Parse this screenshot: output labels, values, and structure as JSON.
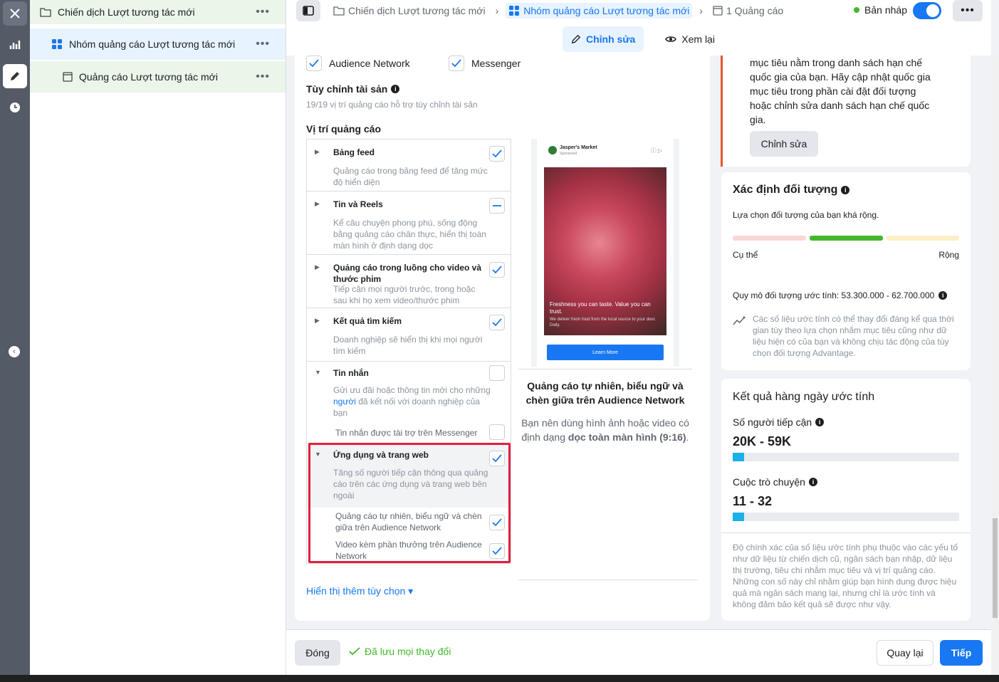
{
  "tree": {
    "campaign": "Chiến dịch Lượt tương tác mới",
    "adset": "Nhóm quảng cáo Lượt tương tác mới",
    "ad": "Quảng cáo Lượt tương tác mới",
    "more": "•••"
  },
  "breadcrumb": {
    "campaign": "Chiến dịch Lượt tương tác mới",
    "adset": "Nhóm quảng cáo Lượt tương tác mới",
    "ads": "1 Quảng cáo"
  },
  "status": {
    "label": "Bản nháp",
    "color": "#42b72a",
    "published": true
  },
  "modes": {
    "edit": "Chỉnh sửa",
    "review": "Xem lại"
  },
  "platforms": {
    "audience_network": "Audience Network",
    "messenger": "Messenger"
  },
  "asset_custom": {
    "title": "Tùy chỉnh tài sản",
    "subtitle": "19/19 vị trí quảng cáo hỗ trợ tùy chỉnh tài sản"
  },
  "placements_title": "Vị trí quảng cáo",
  "placements": [
    {
      "title": "Bảng feed",
      "desc": "Quảng cáo trong bảng feed để tăng mức độ hiển diện",
      "state": "checked"
    },
    {
      "title": "Tin và Reels",
      "desc": "Kể câu chuyện phong phú, sống động bằng quảng cáo chân thực, hiển thị toàn màn hình ở định dạng dọc",
      "state": "partial"
    },
    {
      "title": "Quảng cáo trong luồng cho video và thước phim",
      "desc": "Tiếp cận mọi người trước, trong hoặc sau khi họ xem video/thước phim",
      "state": "checked"
    },
    {
      "title": "Kết quả tìm kiếm",
      "desc": "Doanh nghiệp sẽ hiển thị khi mọi người tìm kiếm",
      "state": "checked"
    },
    {
      "title": "Tin nhắn",
      "desc_a": "Gửi ưu đãi hoặc thông tin mới cho những ",
      "desc_link": "người",
      "desc_b": " đã kết nối với doanh nghiệp của bạn",
      "child": "Tin nhắn được tài trợ trên Messenger",
      "state": "unchecked"
    },
    {
      "title": "Ứng dụng và trang web",
      "desc": "Tăng số người tiếp cận thông qua quảng cáo trên các ứng dụng và trang web bên ngoài",
      "child1": "Quảng cáo tự nhiên, biểu ngữ và chèn giữa trên Audience Network",
      "child2": "Video kèm phần thưởng trên Audience Network",
      "state": "checked"
    }
  ],
  "preview": {
    "brand": "Jasper's Market",
    "sponsored": "Sponsored",
    "caption": "Freshness you can taste. Value you can trust.",
    "caption2": "We deliver fresh food from the local source to your door. Daily.",
    "cta": "Learn More",
    "title": "Quảng cáo tự nhiên, biểu ngữ và chèn giữa trên Audience Network",
    "desc_a": "Bạn nên dùng hình ảnh hoặc video có định dạng ",
    "desc_b": "dọc toàn màn hình (9:16)",
    "desc_c": "."
  },
  "show_more": "Hiển thị thêm tùy chọn",
  "warning": {
    "text": "mục tiêu nằm trong danh sách hạn chế quốc gia của bạn. Hãy cập nhật quốc gia mục tiêu trong phần cài đặt đối tượng hoặc chỉnh sửa danh sách hạn chế quốc gia.",
    "button": "Chỉnh sửa"
  },
  "audience": {
    "title": "Xác định đối tượng",
    "desc": "Lựa chọn đối tượng của bạn khá rộng.",
    "left": "Cụ thể",
    "right": "Rộng",
    "size": "Quy mô đối tượng ước tính: 53.300.000 - 62.700.000",
    "note": "Các số liệu ước tính có thể thay đổi đáng kể qua thời gian tùy theo lựa chọn nhắm mục tiêu cũng như dữ liệu hiện có của bạn và không chịu tác động của tùy chọn đối tượng Advantage."
  },
  "daily": {
    "title": "Kết quả hàng ngày ước tính",
    "reach_label": "Số người tiếp cận",
    "reach": "20K - 59K",
    "reach_fill": 0.05,
    "conv_label": "Cuộc trò chuyện",
    "conv": "11 - 32",
    "conv_fill": 0.05,
    "note": "Độ chính xác của số liệu ước tính phụ thuộc vào các yếu tố như dữ liệu từ chiến dịch cũ, ngân sách bạn nhập, dữ liệu thị trường, tiêu chí nhắm mục tiêu và vị trí quảng cáo. Những con số này chỉ nhằm giúp bạn hình dung được hiệu quả mà ngân sách mang lại, nhưng chỉ là ước tính và không đảm bảo kết quả sẽ được như vậy."
  },
  "footer": {
    "close": "Đóng",
    "saved": "Đã lưu mọi thay đổi",
    "back": "Quay lại",
    "next": "Tiếp"
  }
}
